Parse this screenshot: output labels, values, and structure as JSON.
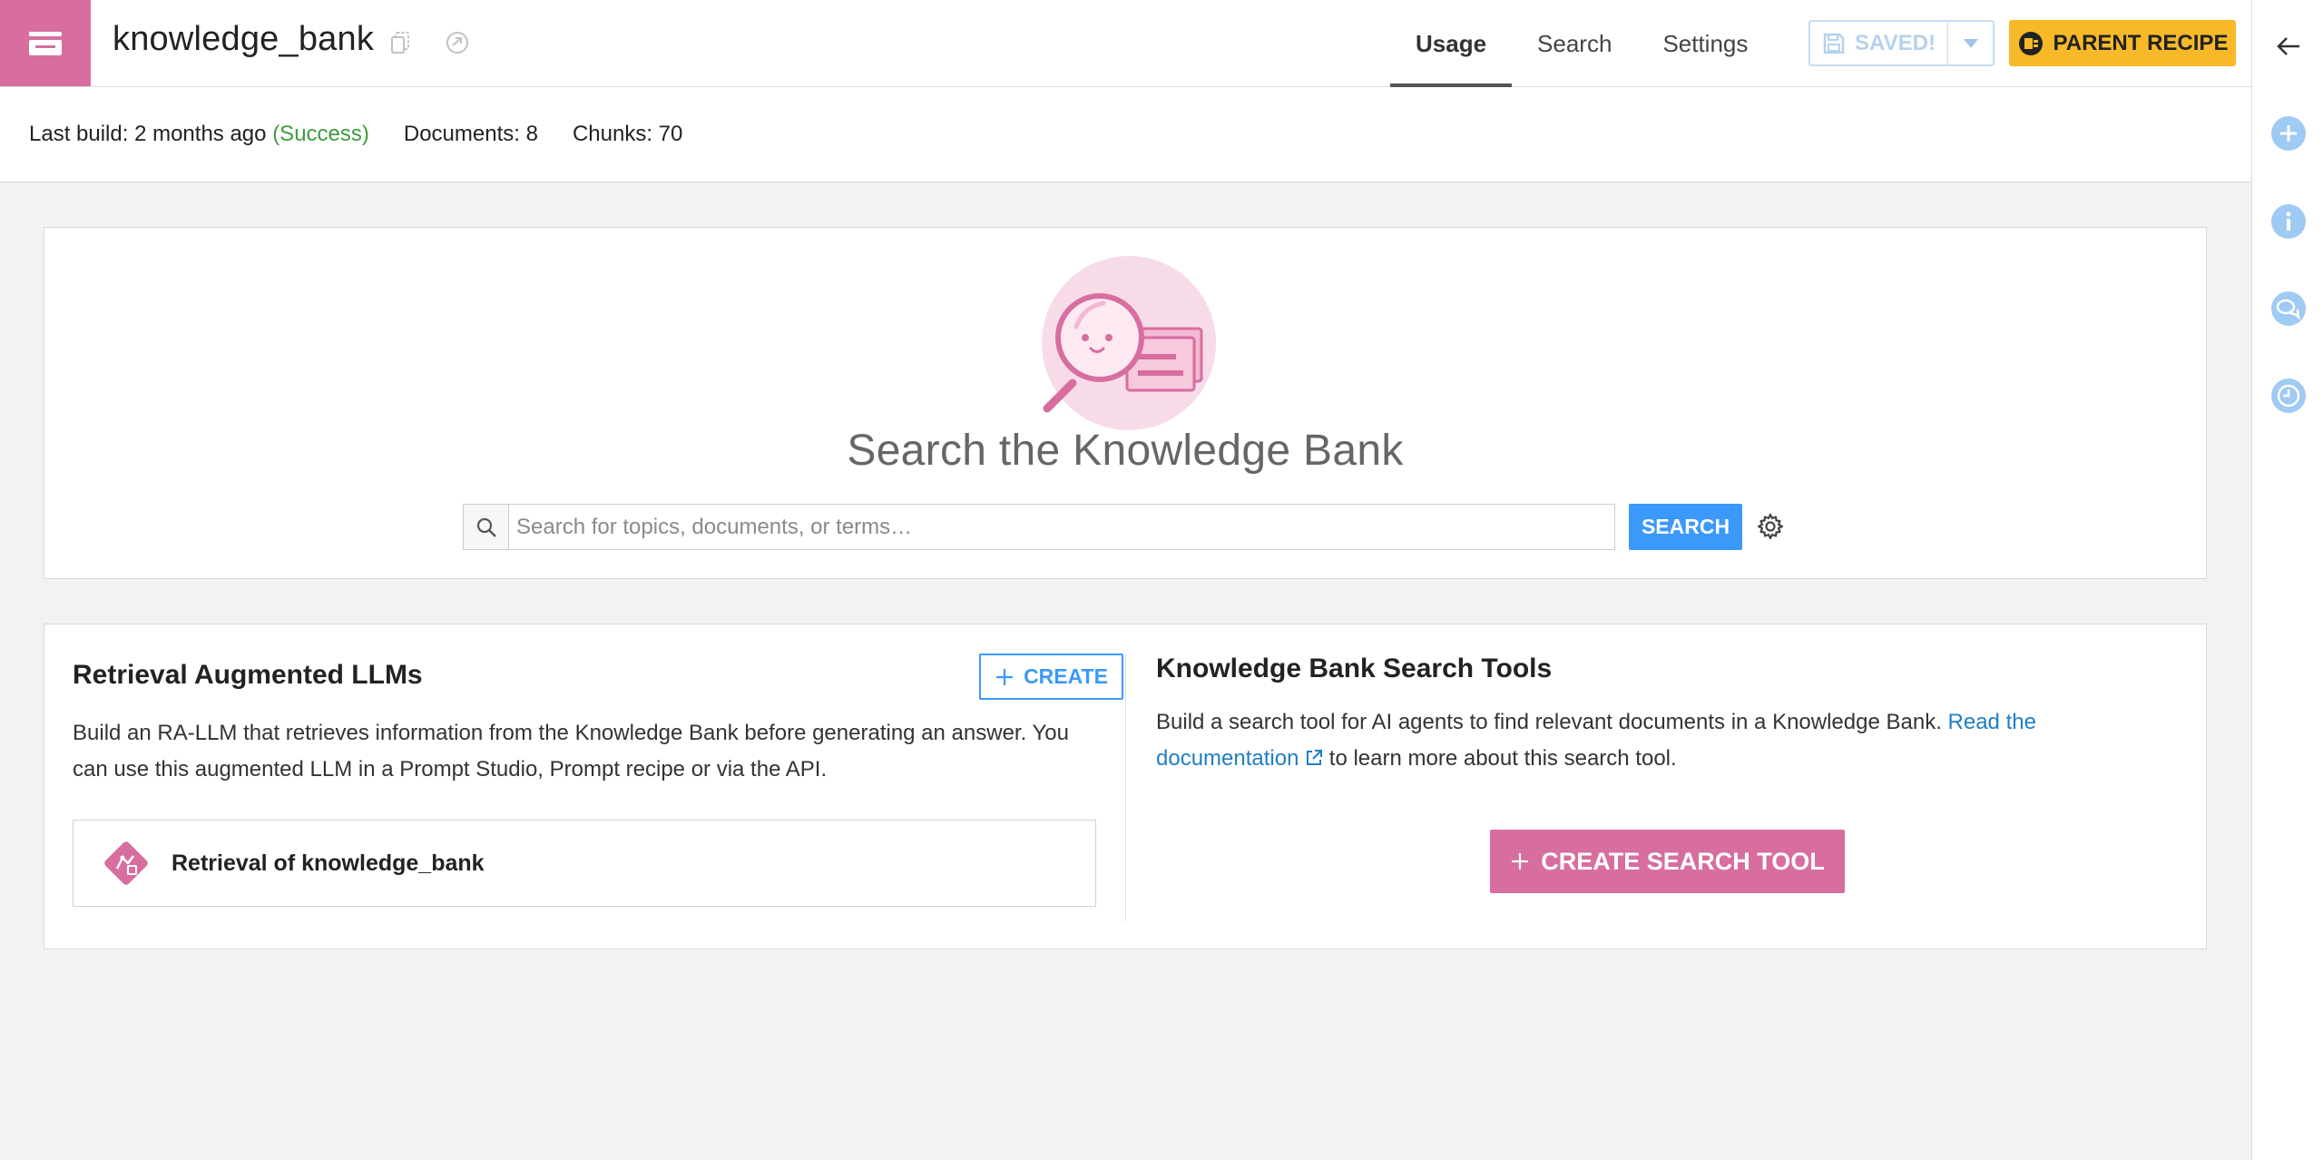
{
  "header": {
    "title": "knowledge_bank",
    "tabs": [
      {
        "label": "Usage",
        "active": true
      },
      {
        "label": "Search",
        "active": false
      },
      {
        "label": "Settings",
        "active": false
      }
    ],
    "saved_label": "SAVED!",
    "parent_recipe_label": "PARENT RECIPE",
    "icons": [
      "knowledge-bank-icon",
      "copy-icon",
      "share-icon",
      "chevron-down-icon",
      "recipe-icon"
    ]
  },
  "status": {
    "last_build_label": "Last build: 2 months ago",
    "last_build_status": "(Success)",
    "documents": "Documents: 8",
    "chunks": "Chunks: 70"
  },
  "search": {
    "title": "Search the Knowledge Bank",
    "placeholder": "Search for topics, documents, or terms…",
    "button_label": "SEARCH"
  },
  "rag": {
    "title": "Retrieval Augmented LLMs",
    "create_label": "CREATE",
    "description": "Build an RA-LLM that retrieves information from the Knowledge Bank before generating an answer. You can use this augmented LLM in a Prompt Studio, Prompt recipe or via the API.",
    "items": [
      {
        "label": "Retrieval of knowledge_bank"
      }
    ]
  },
  "search_tools": {
    "title": "Knowledge Bank Search Tools",
    "description_before": "Build a search tool for AI agents to find relevant documents in a Knowledge Bank. ",
    "link_text": "Read the documentation",
    "description_after": " to learn more about this search tool.",
    "create_label": "CREATE SEARCH TOOL"
  },
  "rail": {
    "icons": [
      "back-arrow-icon",
      "add-icon",
      "info-icon",
      "discussions-icon",
      "history-icon"
    ]
  },
  "colors": {
    "accent_pink": "#d76e9f",
    "primary_blue": "#3b99fc",
    "parent_yellow": "#f7b928",
    "success_green": "#3e9c3e",
    "rail_blue": "#9fcaf3"
  }
}
